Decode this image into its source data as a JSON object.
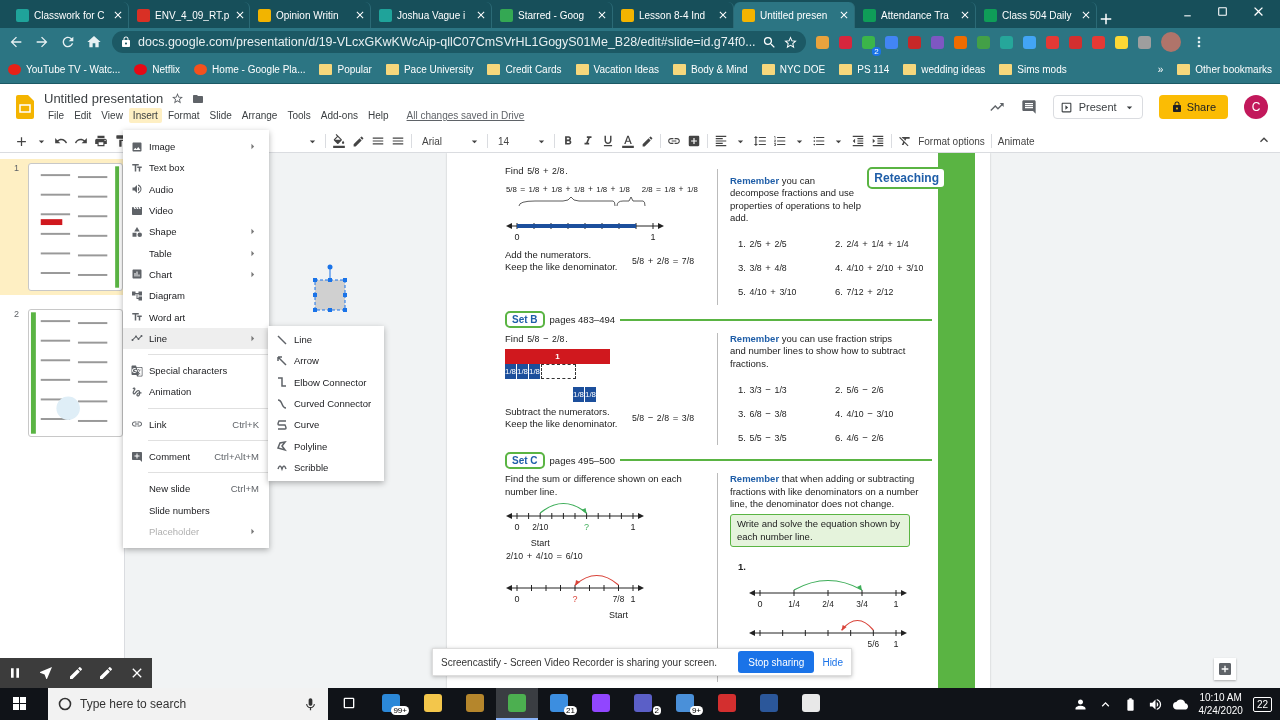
{
  "browser": {
    "tabs": [
      {
        "label": "Classwork for C",
        "color": "#1fa39a",
        "selected": false
      },
      {
        "label": "ENV_4_09_RT.p",
        "color": "#d93025",
        "selected": false
      },
      {
        "label": "Opinion Writin",
        "color": "#f2b400",
        "selected": false
      },
      {
        "label": "Joshua Vague i",
        "color": "#1fa39a",
        "selected": false
      },
      {
        "label": "Starred - Goog",
        "color": "#34a853",
        "selected": false
      },
      {
        "label": "Lesson 8-4 Ind",
        "color": "#f4b400",
        "selected": false
      },
      {
        "label": "Untitled presen",
        "color": "#f4b400",
        "selected": true
      },
      {
        "label": "Attendance Tra",
        "color": "#0f9d58",
        "selected": false
      },
      {
        "label": "Class 504 Daily",
        "color": "#0f9d58",
        "selected": false
      }
    ],
    "url": "docs.google.com/presentation/d/19-VLcxGKwKWcAip-qllC07CmSVrHL1GogyS01Me_B28/edit#slide=id.g74f0...",
    "extension_badge": "2",
    "bookmarks": [
      {
        "label": "YouTube TV - Watc...",
        "kind": "site",
        "color": "#e62117"
      },
      {
        "label": "Netflix",
        "kind": "site",
        "color": "#e50914"
      },
      {
        "label": "Home - Google Pla...",
        "kind": "site",
        "color": "#f4511e"
      },
      {
        "label": "Popular",
        "kind": "folder",
        "color": "#f6d77c"
      },
      {
        "label": "Pace University",
        "kind": "folder",
        "color": "#f6d77c"
      },
      {
        "label": "Credit Cards",
        "kind": "folder",
        "color": "#f6d77c"
      },
      {
        "label": "Vacation Ideas",
        "kind": "folder",
        "color": "#f6d77c"
      },
      {
        "label": "Body & Mind",
        "kind": "folder",
        "color": "#f6d77c"
      },
      {
        "label": "NYC DOE",
        "kind": "folder",
        "color": "#f6d77c"
      },
      {
        "label": "PS 114",
        "kind": "folder",
        "color": "#f6d77c"
      },
      {
        "label": "wedding ideas",
        "kind": "folder",
        "color": "#f6d77c"
      },
      {
        "label": "Sims mods",
        "kind": "folder",
        "color": "#f6d77c"
      }
    ],
    "more_bookmarks": "»",
    "other_bookmarks": "Other bookmarks"
  },
  "app": {
    "title": "Untitled presentation",
    "menus": [
      {
        "label": "File",
        "selected": false
      },
      {
        "label": "Edit",
        "selected": false
      },
      {
        "label": "View",
        "selected": false
      },
      {
        "label": "Insert",
        "selected": true
      },
      {
        "label": "Format",
        "selected": false
      },
      {
        "label": "Slide",
        "selected": false
      },
      {
        "label": "Arrange",
        "selected": false
      },
      {
        "label": "Tools",
        "selected": false
      },
      {
        "label": "Add-ons",
        "selected": false
      },
      {
        "label": "Help",
        "selected": false
      }
    ],
    "save_status": "All changes saved in Drive",
    "present": "Present",
    "share": "Share",
    "avatar": "C",
    "toolbar": {
      "font": "Arial",
      "size": "14",
      "format_options": "Format options",
      "animate": "Animate"
    }
  },
  "filmstrip": [
    {
      "number": "1",
      "selected": true
    },
    {
      "number": "2",
      "selected": false
    }
  ],
  "insert_menu": [
    {
      "kind": "item",
      "label": "Image",
      "submenu": true,
      "selected": false,
      "disabled": false
    },
    {
      "kind": "item",
      "label": "Text box",
      "submenu": false,
      "selected": false,
      "disabled": false
    },
    {
      "kind": "item",
      "label": "Audio",
      "submenu": false,
      "selected": false,
      "disabled": false
    },
    {
      "kind": "item",
      "label": "Video",
      "submenu": false,
      "selected": false,
      "disabled": false
    },
    {
      "kind": "item",
      "label": "Shape",
      "submenu": true,
      "selected": false,
      "disabled": false
    },
    {
      "kind": "item",
      "label": "Table",
      "submenu": true,
      "selected": false,
      "disabled": false
    },
    {
      "kind": "item",
      "label": "Chart",
      "submenu": true,
      "selected": false,
      "disabled": false
    },
    {
      "kind": "item",
      "label": "Diagram",
      "submenu": false,
      "selected": false,
      "disabled": false
    },
    {
      "kind": "item",
      "label": "Word art",
      "submenu": false,
      "selected": false,
      "disabled": false
    },
    {
      "kind": "item",
      "label": "Line",
      "submenu": true,
      "selected": true,
      "disabled": false
    },
    {
      "kind": "divider"
    },
    {
      "kind": "item",
      "label": "Special characters",
      "submenu": false,
      "selected": false,
      "disabled": false
    },
    {
      "kind": "item",
      "label": "Animation",
      "submenu": false,
      "selected": false,
      "disabled": false
    },
    {
      "kind": "divider"
    },
    {
      "kind": "item",
      "label": "Link",
      "shortcut": "Ctrl+K",
      "submenu": false,
      "selected": false,
      "disabled": false
    },
    {
      "kind": "divider"
    },
    {
      "kind": "item",
      "label": "Comment",
      "shortcut": "Ctrl+Alt+M",
      "submenu": false,
      "selected": false,
      "disabled": false
    },
    {
      "kind": "divider"
    },
    {
      "kind": "item",
      "label": "New slide",
      "shortcut": "Ctrl+M",
      "submenu": false,
      "selected": false,
      "disabled": false
    },
    {
      "kind": "item",
      "label": "Slide numbers",
      "submenu": false,
      "selected": false,
      "disabled": false
    },
    {
      "kind": "item",
      "label": "Placeholder",
      "submenu": true,
      "selected": false,
      "disabled": true
    }
  ],
  "line_submenu": [
    "Line",
    "Arrow",
    "Elbow Connector",
    "Curved Connector",
    "Curve",
    "Polyline",
    "Scribble"
  ],
  "slide": {
    "badge": "Reteaching",
    "set_a": {
      "find": "Find 5/8 + 2/8.",
      "decompose": [
        "5/8 = 1/8 + 1/8 + 1/8 + 1/8 + 1/8",
        "2/8 = 1/8 + 1/8"
      ],
      "number_line": {
        "labels": [
          "0",
          "1"
        ]
      },
      "steps": [
        "Add the numerators.",
        "Keep the like denominator."
      ],
      "equation": "5/8 + 2/8 = 7/8",
      "remember": "**Remember** you can decompose fractions and use properties of operations to help add.",
      "problems": [
        "1. 2/5 + 2/5",
        "2. 2/4 + 1/4 + 1/4",
        "3. 3/8 + 4/8",
        "4. 4/10 + 2/10 + 3/10",
        "5. 4/10 + 3/10",
        "6. 7/12 + 2/12"
      ]
    },
    "set_b": {
      "label": "Set B",
      "pages": "pages 483–494",
      "find": "Find 5/8 − 2/8.",
      "whole": "1",
      "cells": [
        "1/8",
        "1/8",
        "1/8"
      ],
      "moved_cells": [
        "1/8",
        "1/8"
      ],
      "steps": [
        "Subtract the numerators.",
        "Keep the like denominator."
      ],
      "equation": "5/8 − 2/8 = 3/8",
      "remember": "**Remember** you can use fraction strips and number lines to show how to subtract fractions.",
      "problems": [
        "1. 3/3 − 1/3",
        "2. 5/6 − 2/6",
        "3. 6/8 − 3/8",
        "4. 4/10 − 3/10",
        "5. 5/5 − 3/5",
        "6. 4/6 − 2/6"
      ]
    },
    "set_c": {
      "label": "Set C",
      "pages": "pages 495–500",
      "find": "Find the sum or difference shown on each number line.",
      "left_lines": [
        {
          "labels": [
            "0",
            "2/10",
            "?",
            "1"
          ],
          "start_label": "Start"
        },
        {
          "labels": [
            "0",
            "?",
            "7/8",
            "1"
          ],
          "start_label": "Start"
        }
      ],
      "equation": "2/10 + 4/10 = 6/10",
      "remember": "**Remember** that when adding or subtracting fractions with like denominators on a number line, the denominator does not change.",
      "instruction": "Write and solve the equation shown by each number line.",
      "problem_number": "1.",
      "right_lines": [
        {
          "labels": [
            "0",
            "1/4",
            "2/4",
            "3/4",
            "1"
          ]
        },
        {
          "labels": [
            "5/6",
            "1"
          ]
        }
      ]
    }
  },
  "share_banner": {
    "text": "Screencastify - Screen Video Recorder is sharing your screen.",
    "stop": "Stop sharing",
    "hide": "Hide"
  },
  "taskbar": {
    "search_placeholder": "Type here to search",
    "apps": [
      {
        "color": "#2b88d8",
        "badge": "99+",
        "selected": false
      },
      {
        "color": "#f3c64b",
        "selected": false
      },
      {
        "color": "#b5862c",
        "selected": false
      },
      {
        "color": "#4caf50",
        "selected": true
      },
      {
        "color": "#3c8ee0",
        "badge": "21",
        "selected": false
      },
      {
        "color": "#9146ff",
        "selected": false
      },
      {
        "color": "#5b5fc7",
        "badge": "2",
        "selected": false
      },
      {
        "color": "#4a90d9",
        "badge": "9+",
        "selected": false
      },
      {
        "color": "#d32f2f",
        "selected": false
      },
      {
        "color": "#2b579a",
        "selected": false
      },
      {
        "color": "#e8e8e8",
        "selected": false
      }
    ],
    "time": "10:10 AM",
    "date": "4/24/2020",
    "notifications": "22"
  }
}
